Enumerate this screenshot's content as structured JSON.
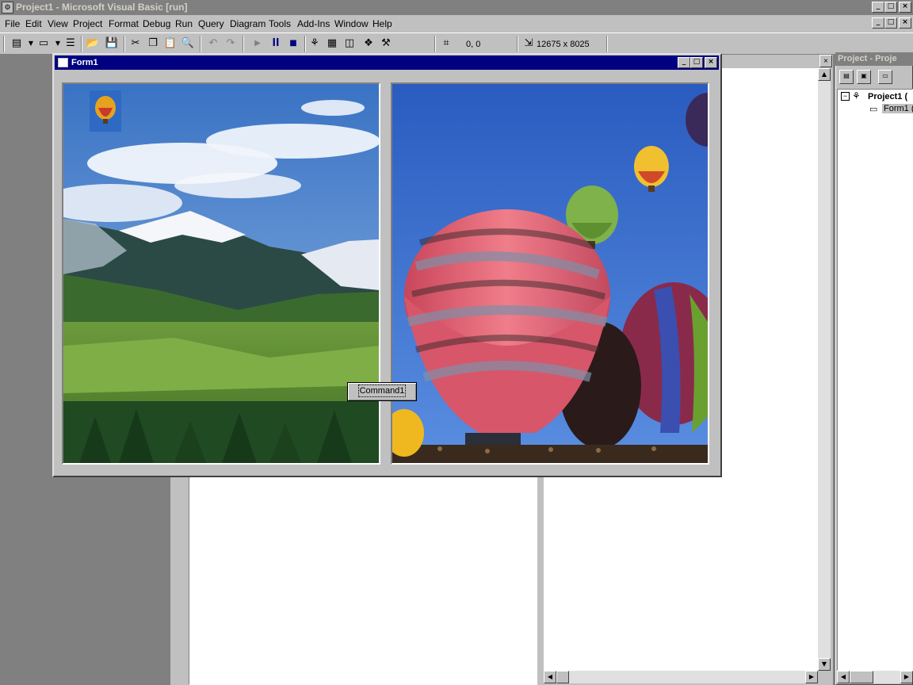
{
  "app": {
    "title": "Project1 - Microsoft Visual Basic [run]",
    "icon": "vb-app-icon"
  },
  "window_controls": {
    "minimize": "_",
    "maximize": "□",
    "close": "×"
  },
  "menu": [
    {
      "label": "File"
    },
    {
      "label": "Edit"
    },
    {
      "label": "View"
    },
    {
      "label": "Project"
    },
    {
      "label": "Format"
    },
    {
      "label": "Debug"
    },
    {
      "label": "Run"
    },
    {
      "label": "Query"
    },
    {
      "label": "Diagram"
    },
    {
      "label": "Tools"
    },
    {
      "label": "Add-Ins"
    },
    {
      "label": "Window"
    },
    {
      "label": "Help"
    }
  ],
  "toolbar": {
    "position_readout": "0, 0",
    "size_readout": "12675 x 8025",
    "icons": [
      "add-project-icon",
      "add-form-icon",
      "menu-editor-icon",
      "open-icon",
      "save-icon",
      "cut-icon",
      "copy-icon",
      "paste-icon",
      "find-icon",
      "undo-icon",
      "redo-icon",
      "start-icon",
      "break-icon",
      "end-icon",
      "project-explorer-icon",
      "properties-icon",
      "form-layout-icon",
      "object-browser-icon",
      "toolbox-icon"
    ]
  },
  "form1": {
    "title": "Form1",
    "command_button": "Command1"
  },
  "project_explorer": {
    "title": "Project - Proje",
    "root": "Project1 (",
    "child": "Form1 ("
  },
  "colors": {
    "active_title": "#000080",
    "inactive_title": "#808080",
    "face": "#c0c0c0",
    "sky": "#3f7ad0"
  }
}
